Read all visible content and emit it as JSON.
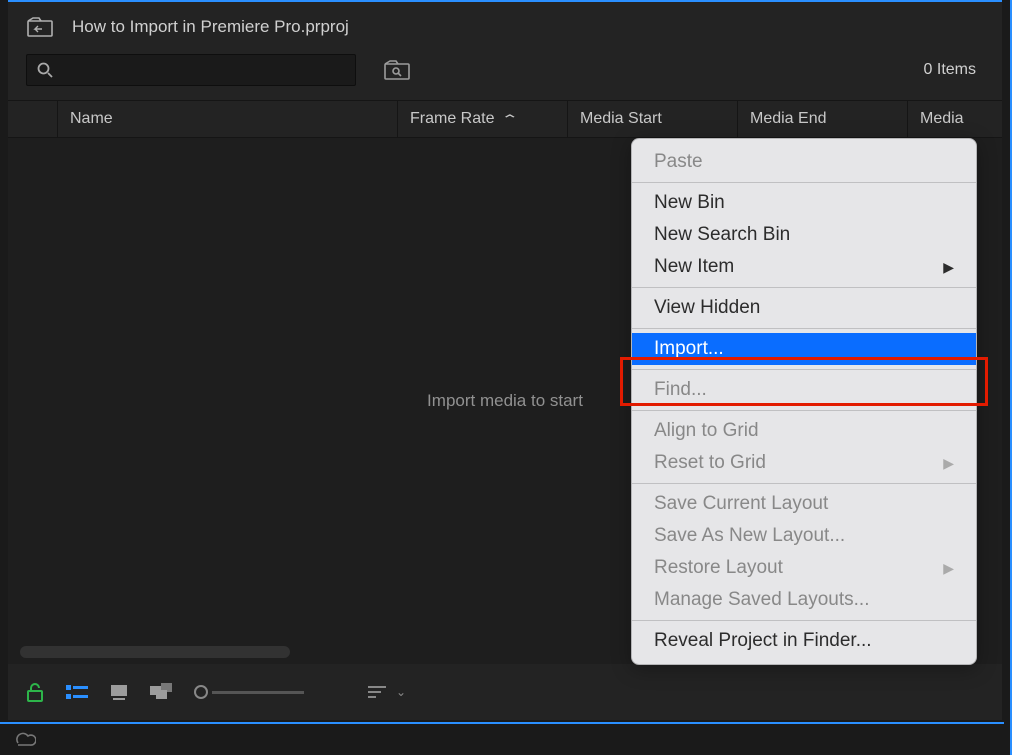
{
  "project_title": "How to Import in Premiere Pro.prproj",
  "items_count": "0 Items",
  "columns": {
    "name": "Name",
    "frame_rate": "Frame Rate",
    "media_start": "Media Start",
    "media_end": "Media End",
    "media": "Media"
  },
  "body_placeholder": "Import media to start",
  "context_menu": {
    "paste": "Paste",
    "new_bin": "New Bin",
    "new_search_bin": "New Search Bin",
    "new_item": "New Item",
    "view_hidden": "View Hidden",
    "import": "Import...",
    "find": "Find...",
    "align_grid": "Align to Grid",
    "reset_grid": "Reset to Grid",
    "save_layout": "Save Current Layout",
    "save_as_layout": "Save As New Layout...",
    "restore_layout": "Restore Layout",
    "manage_layouts": "Manage Saved Layouts...",
    "reveal_finder": "Reveal Project in Finder..."
  }
}
